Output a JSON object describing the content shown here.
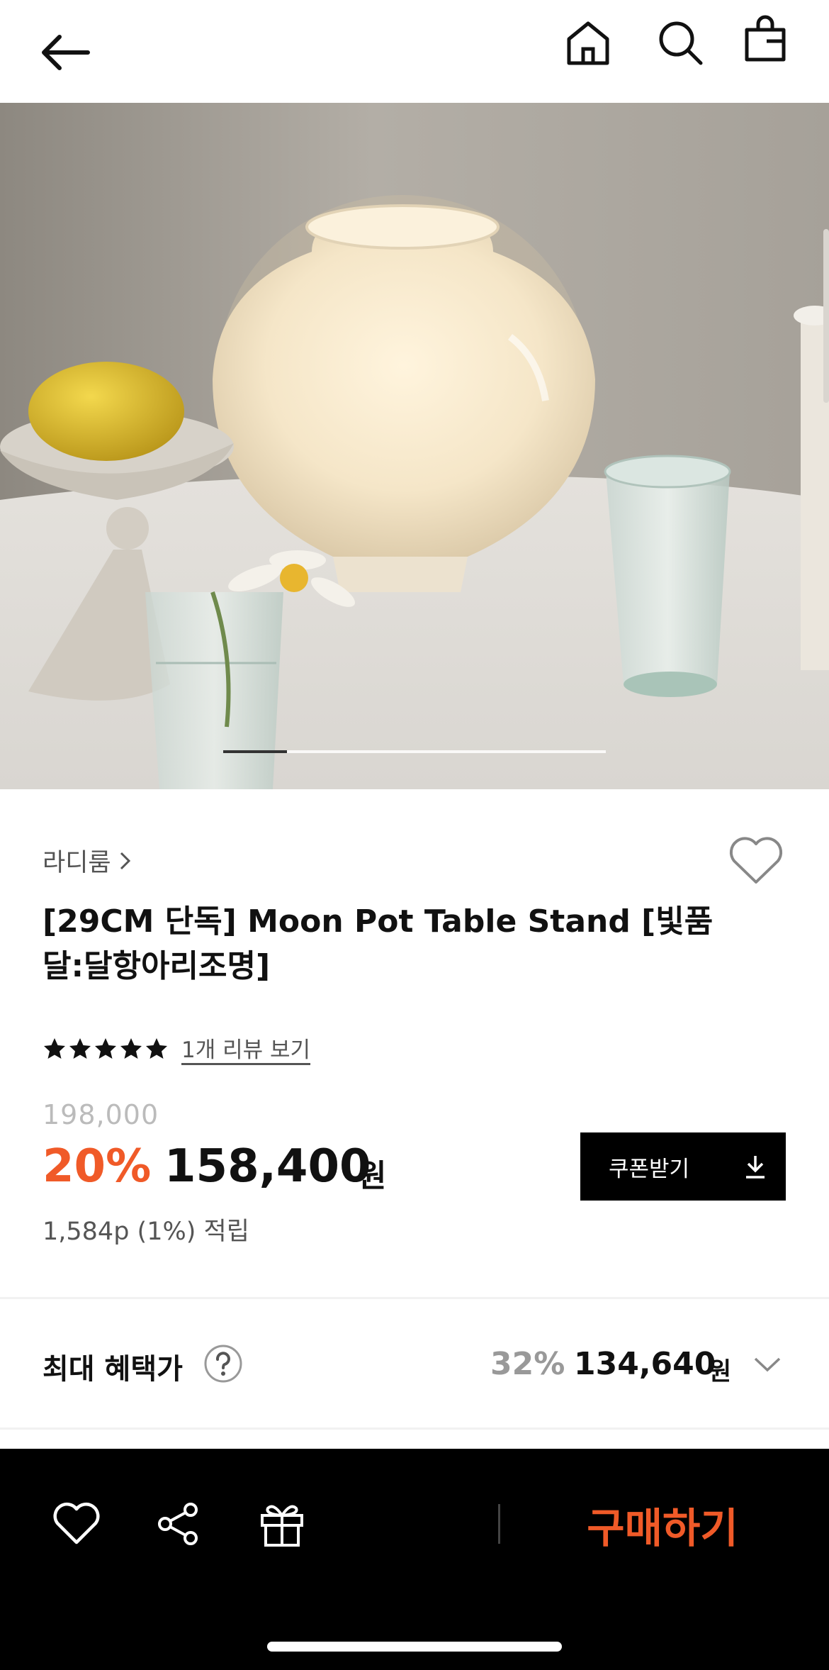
{
  "nav": {
    "back_icon": "arrow-left-icon",
    "home_icon": "home-icon",
    "search_icon": "search-icon",
    "bag_icon": "shopping-bag-icon"
  },
  "gallery": {
    "progress_fraction": 0.167
  },
  "product": {
    "brand": "라디룸",
    "title": "[29CM 단독] Moon Pot Table Stand [빛품달:달항아리조명]",
    "rating_stars": 5,
    "review_link": "1개 리뷰 보기",
    "original_price": "198,000",
    "discount": "20%",
    "price": "158,400",
    "currency": "원",
    "points": "1,584p (1%) 적립",
    "coupon_label": "쿠폰받기"
  },
  "benefit": {
    "label": "최대 혜택가",
    "discount": "32%",
    "price": "134,640",
    "currency": "원"
  },
  "bottom_bar": {
    "buy_label": "구매하기"
  },
  "colors": {
    "accent": "#f05a28",
    "dark": "#000000",
    "muted": "#999999"
  }
}
